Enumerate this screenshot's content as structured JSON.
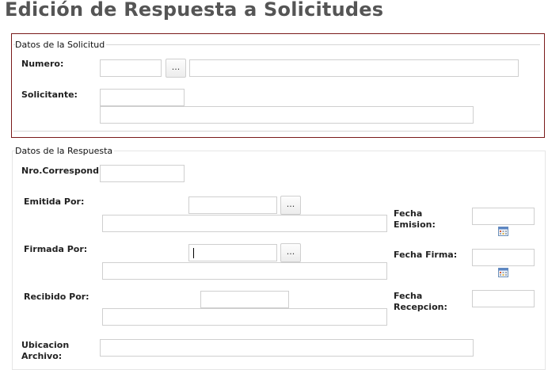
{
  "page": {
    "title": "Edición de Respuesta a Solicitudes"
  },
  "solicitud": {
    "legend": "Datos de la Solicitud",
    "numero_label": "Numero:",
    "solicitante_label": "Solicitante:",
    "browse_label": "..."
  },
  "respuesta": {
    "legend": "Datos de la Respuesta",
    "nro_correspond_label": "Nro.Correspond",
    "emitida_por_label": "Emitida Por:",
    "firmada_por_label": "Firmada Por:",
    "recibido_por_label": "Recibido Por:",
    "ubicacion_archivo_label_line1": "Ubicacion",
    "ubicacion_archivo_label_line2": "Archivo:",
    "fecha_emision_label_line1": "Fecha",
    "fecha_emision_label_line2": "Emision:",
    "fecha_firma_label": "Fecha Firma:",
    "fecha_recepcion_label_line1": "Fecha",
    "fecha_recepcion_label_line2": "Recepcion:",
    "browse_label": "..."
  },
  "icons": {
    "calendar": "calendar-icon",
    "browse": "ellipsis-button"
  },
  "colors": {
    "title": "#555555",
    "selected_border": "#7a1a1a",
    "input_border": "#cfcfcf"
  }
}
